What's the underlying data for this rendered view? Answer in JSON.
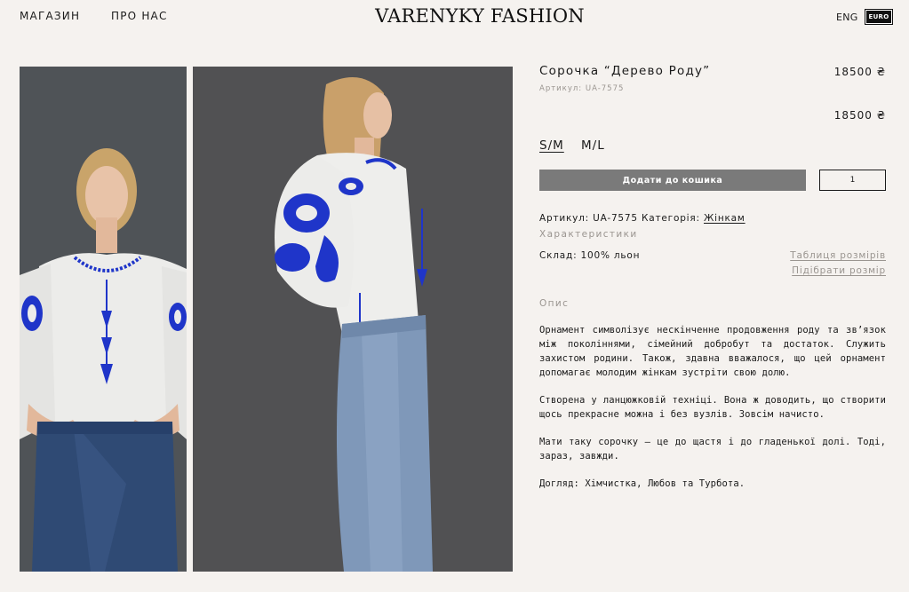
{
  "header": {
    "nav": [
      "МАГАЗИН",
      "ПРО НАС"
    ],
    "logo": "VARENYKY FASHION",
    "lang": "ENG",
    "currency": "EURO"
  },
  "product": {
    "title": "Сорочка “Дерево Роду”",
    "price": "18500 ₴",
    "article_small": "Артикул: UA-7575",
    "price_secondary": "18500 ₴",
    "sizes": [
      "S/M",
      "M/L"
    ],
    "selected_size": "S/M",
    "add_to_cart": "Додати до кошика",
    "quantity": "1",
    "meta_prefix": "Артикул: UA-7575 Категорія: ",
    "category": "Жінкам",
    "characteristics_label": "Характеристики",
    "composition": "Склад: 100% льон",
    "size_table_link": "Таблиця розмірів",
    "size_pick_link": "Підібрати розмір",
    "description_label": "Опис",
    "description": [
      "Орнамент символізує нескінченне продовження роду та зв’язок між поколіннями, сімейний добробут та достаток. Служить захистом родини. Також, здавна вважалося, що цей орнамент допомагає молодим жінкам зустріти свою долю.",
      "Створена у ланцюжковій техніці. Вона ж доводить, що створити щось прекрасне можна і без вузлів. Зовсім начисто.",
      "Мати таку сорочку — це до щастя і до гладенької долі. Тоді, зараз, завжди.",
      "Догляд: Хімчистка, Любов та Турбота."
    ]
  },
  "colors": {
    "background": "#f5f2ef",
    "button": "#7a7a7a",
    "embroidery": "#1f35c9",
    "muted": "#9a9590"
  }
}
